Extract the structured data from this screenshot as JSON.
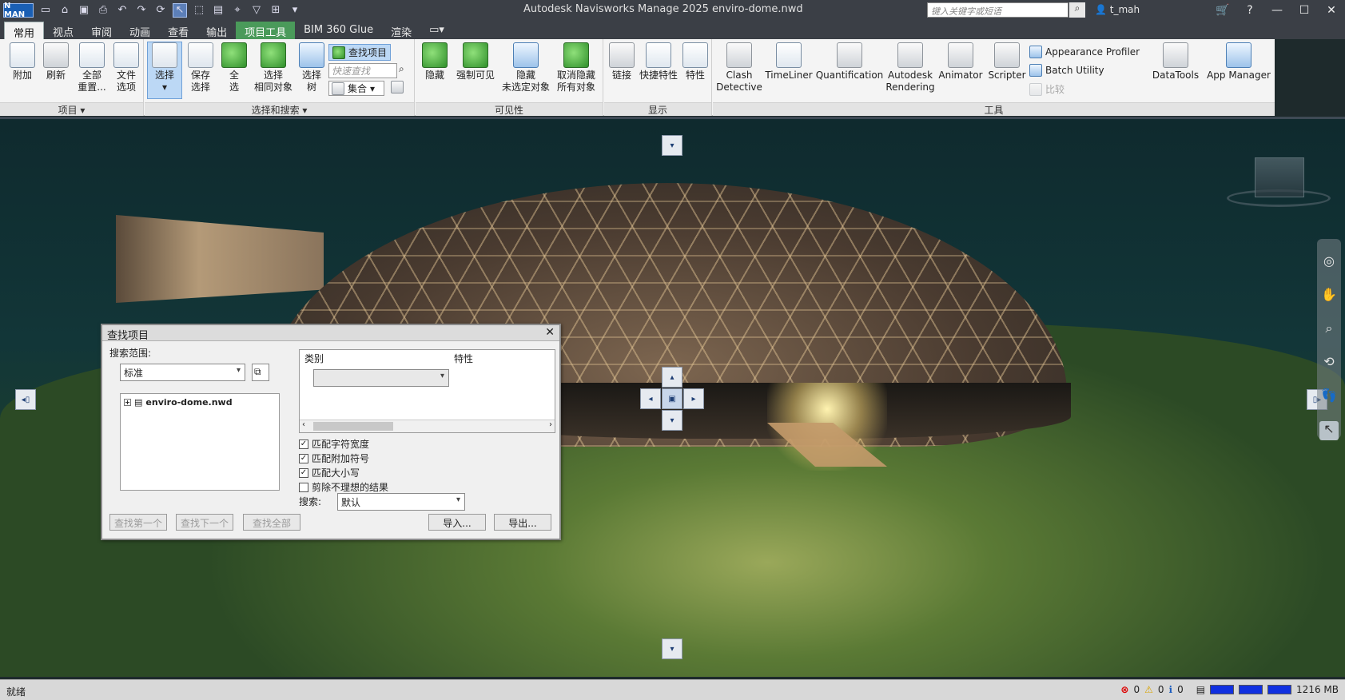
{
  "titlebar": {
    "logo": "N MAN",
    "app_title": "Autodesk Navisworks Manage 2025    enviro-dome.nwd",
    "search_placeholder": "键入关键字或短语",
    "user": "t_mah"
  },
  "tabs": [
    "常用",
    "视点",
    "审阅",
    "动画",
    "查看",
    "输出",
    "项目工具",
    "BIM 360 Glue",
    "渲染"
  ],
  "ribbon": {
    "project": {
      "title": "项目",
      "append": "附加",
      "refresh": "刷新",
      "reset_all_1": "全部",
      "reset_all_2": "重置...",
      "file_options_1": "文件",
      "file_options_2": "选项"
    },
    "select": {
      "title": "选择和搜索",
      "select": "选择",
      "save_selection_1": "保存",
      "save_selection_2": "选择",
      "select_all_1": "全",
      "select_all_2": "选",
      "select_same_1": "选择",
      "select_same_2": "相同对象",
      "selection_tree_1": "选择",
      "selection_tree_2": "树",
      "find_items": "查找项目",
      "quick_find_placeholder": "快速查找",
      "sets": "集合"
    },
    "visibility": {
      "title": "可见性",
      "hide": "隐藏",
      "require": "强制可见",
      "hide_unselected_1": "隐藏",
      "hide_unselected_2": "未选定对象",
      "unhide_all_1": "取消隐藏",
      "unhide_all_2": "所有对象"
    },
    "display": {
      "title": "显示",
      "links": "链接",
      "quick_props": "快捷特性",
      "properties": "特性"
    },
    "tools": {
      "title": "工具",
      "clash_1": "Clash",
      "clash_2": "Detective",
      "timeliner": "TimeLiner",
      "quantification": "Quantification",
      "rendering_1": "Autodesk",
      "rendering_2": "Rendering",
      "animator": "Animator",
      "scripter": "Scripter",
      "appearance_profiler": "Appearance Profiler",
      "batch_utility": "Batch Utility",
      "compare": "比较",
      "datatools": "DataTools",
      "app_manager": "App Manager"
    }
  },
  "dialog": {
    "title": "查找项目",
    "search_in": "搜索范围:",
    "scope": "标准",
    "tree_item": "enviro-dome.nwd",
    "col_category": "类别",
    "col_property": "特性",
    "match_width": "匹配字符宽度",
    "match_diacritics": "匹配附加符号",
    "match_case": "匹配大小写",
    "prune": "剪除不理想的结果",
    "search_label": "搜索:",
    "search_mode": "默认",
    "find_first": "查找第一个",
    "find_next": "查找下一个",
    "find_all": "查找全部",
    "import": "导入...",
    "export": "导出..."
  },
  "statusbar": {
    "status": "就绪",
    "errors": "0",
    "warnings": "0",
    "infos": "0",
    "memory": "1216 MB"
  }
}
